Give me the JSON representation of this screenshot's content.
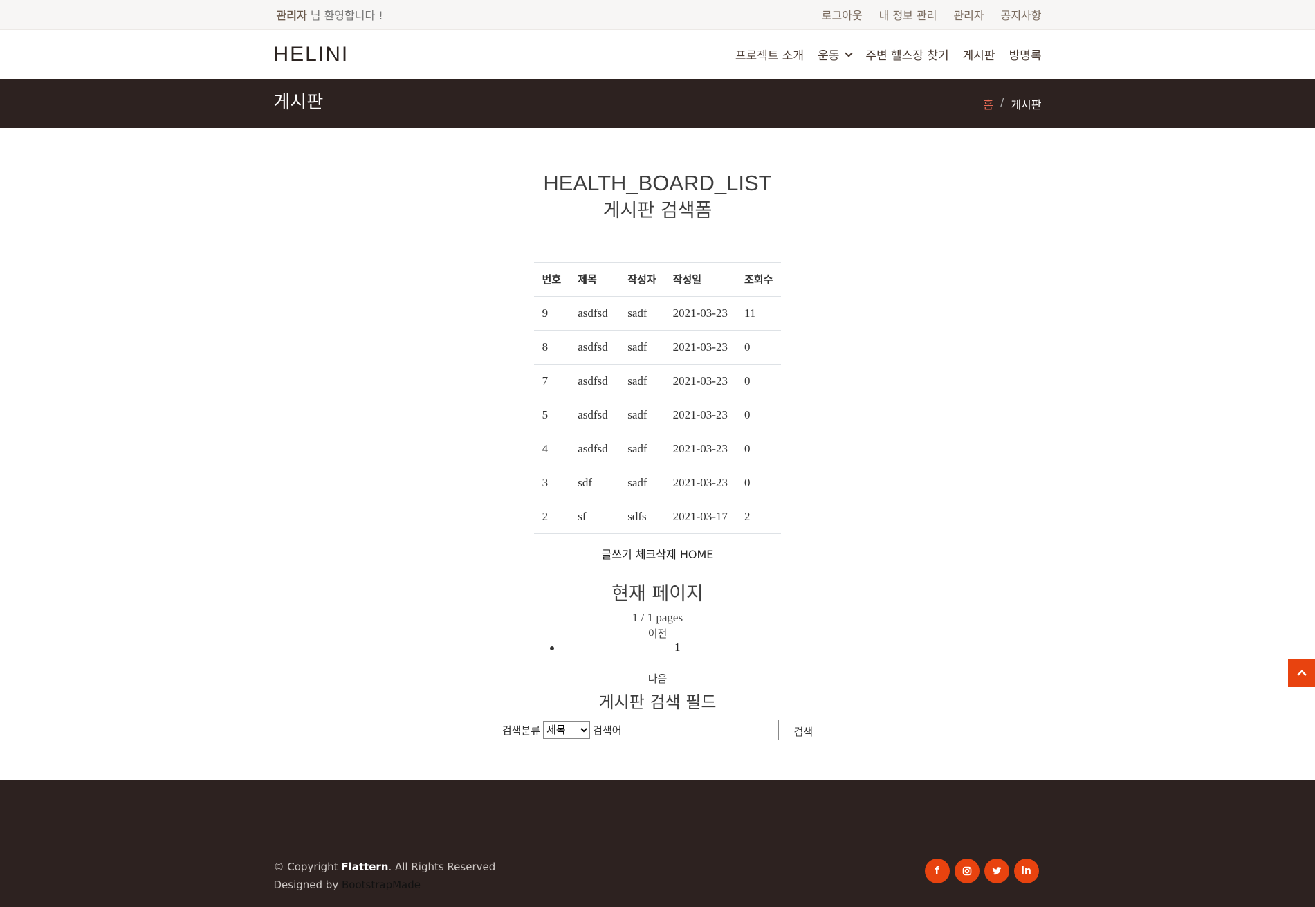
{
  "topbar": {
    "user": "관리자",
    "welcome_suffix": " 님 환영합니다 !",
    "links": [
      "로그아웃",
      "내 정보 관리",
      "관리자",
      "공지사항"
    ]
  },
  "header": {
    "logo": "HELINI",
    "nav": [
      "프로젝트 소개",
      "운동",
      "주변 헬스장 찾기",
      "게시판",
      "방명록"
    ]
  },
  "breadcrumb": {
    "title": "게시판",
    "home": "홈",
    "separator": "/",
    "current": "게시판"
  },
  "main": {
    "title": "HEALTH_BOARD_LIST",
    "subtitle": "게시판 검색폼",
    "table": {
      "headers": [
        "번호",
        "제목",
        "작성자",
        "작성일",
        "조회수"
      ],
      "rows": [
        [
          "9",
          "asdfsd",
          "sadf",
          "2021-03-23",
          "11"
        ],
        [
          "8",
          "asdfsd",
          "sadf",
          "2021-03-23",
          "0"
        ],
        [
          "7",
          "asdfsd",
          "sadf",
          "2021-03-23",
          "0"
        ],
        [
          "5",
          "asdfsd",
          "sadf",
          "2021-03-23",
          "0"
        ],
        [
          "4",
          "asdfsd",
          "sadf",
          "2021-03-23",
          "0"
        ],
        [
          "3",
          "sdf",
          "sadf",
          "2021-03-23",
          "0"
        ],
        [
          "2",
          "sf",
          "sdfs",
          "2021-03-17",
          "2"
        ]
      ]
    },
    "actions": {
      "write": "글쓰기",
      "check_delete": "체크삭제",
      "home": "HOME"
    },
    "paging": {
      "heading": "현재 페이지",
      "count": "1 / 1 pages",
      "prev": "이전",
      "page": "1",
      "next": "다음"
    },
    "search": {
      "heading": "게시판 검색 필드",
      "category_label": "검색분류",
      "category_value": "제목",
      "keyword_label": "검색어",
      "keyword_value": "",
      "button": "검색"
    }
  },
  "footer": {
    "copyright_prefix": "© Copyright ",
    "brand": "Flattern",
    "copyright_suffix": ". All Rights Reserved",
    "designed_prefix": "Designed by ",
    "designer": "BootstrapMade",
    "socials": [
      "facebook",
      "instagram",
      "twitter",
      "linkedin"
    ]
  },
  "colors": {
    "accent": "#e8430f",
    "dark_bar": "#2d2220",
    "breadcrumb_home": "#e96b56"
  }
}
